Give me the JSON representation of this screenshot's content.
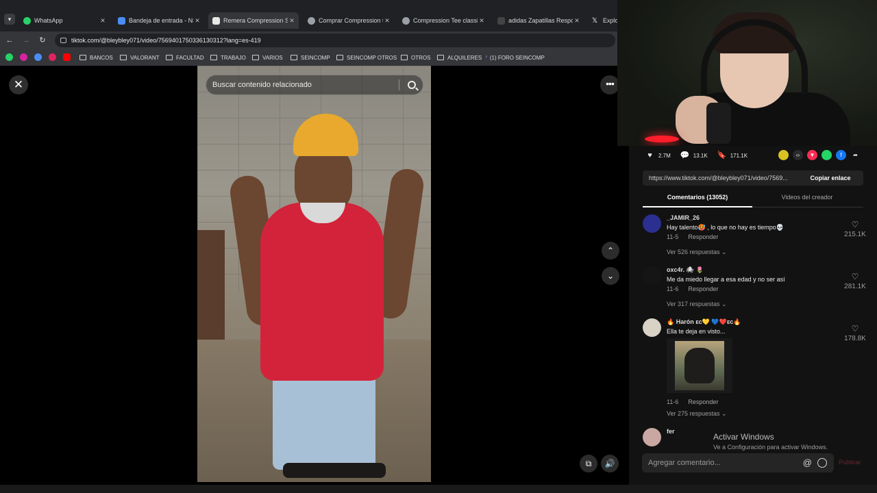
{
  "browser": {
    "tabs": [
      {
        "title": "WhatsApp",
        "color": "#25d366"
      },
      {
        "title": "Bandeja de entrada - Nic...",
        "color": "#4a8ef5"
      },
      {
        "title": "Remera Compression Shi...",
        "color": "#e8e8e8"
      },
      {
        "title": "Comprar Compression te...",
        "color": "#9aa0a6"
      },
      {
        "title": "Compression Tee classic b...",
        "color": "#9aa0a6"
      },
      {
        "title": "adidas Zapatillas Respons...",
        "color": "#202124"
      },
      {
        "title": "Explot",
        "color": "#ffffff"
      }
    ],
    "url": "tiktok.com/@bleybley071/video/7569401750336130312?lang=es-419",
    "bookmarks": [
      "BANCOS",
      "VALORANT",
      "FACULTAD",
      "TRABAJO",
      "VARIOS",
      "SEINCOMP",
      "SEINCOMP OTROS",
      "OTROS",
      "ALQUILERES",
      "(1) FORO SEINCOMP"
    ]
  },
  "video": {
    "search_placeholder": "Buscar contenido relacionado",
    "close_glyph": "✕",
    "more_glyph": "•••",
    "up_glyph": "⌃",
    "down_glyph": "⌄",
    "volume_glyph": "🔊",
    "pip_glyph": "⧉"
  },
  "actions": {
    "likes": "2.7M",
    "comments": "13.1K",
    "saves": "171.1K"
  },
  "link": {
    "url": "https://www.tiktok.com/@bleybley071/video/7569...",
    "copy_label": "Copiar enlace"
  },
  "panel_tabs": {
    "comments": "Comentarios (13052)",
    "creator_videos": "Videos del creador"
  },
  "comments": [
    {
      "user": "_JAMIR_26",
      "text": "Hay talento🥵 , lo que no hay es tiempo💀",
      "date": "11-5",
      "reply": "Responder",
      "likes": "215.1K",
      "replies": "Ver 526 respuestas ⌄",
      "avatar_color": "#2b2f8f"
    },
    {
      "user": "oxc4r. 🕷 🌷",
      "text": "Me da miedo llegar a esa edad y no ser así",
      "date": "11-6",
      "reply": "Responder",
      "likes": "281.1K",
      "replies": "Ver 317 respuestas ⌄",
      "avatar_color": "#151515"
    },
    {
      "user": "🔥 Harón ᴇᴄ💛 💙❤️ᴇᴄ🔥",
      "text": "Ella te deja en visto...",
      "date": "11-6",
      "reply": "Responder",
      "likes": "178.8K",
      "replies": "Ver 275 respuestas ⌄",
      "avatar_color": "#d8d2c6"
    },
    {
      "user": "fer",
      "avatar_color": "#c9a7a2"
    }
  ],
  "windows_watermark": {
    "title": "Activar Windows",
    "subtitle": "Ve a Configuración para activar Windows."
  },
  "comment_box": {
    "placeholder": "Agregar comentario...",
    "publish": "Publicar"
  }
}
